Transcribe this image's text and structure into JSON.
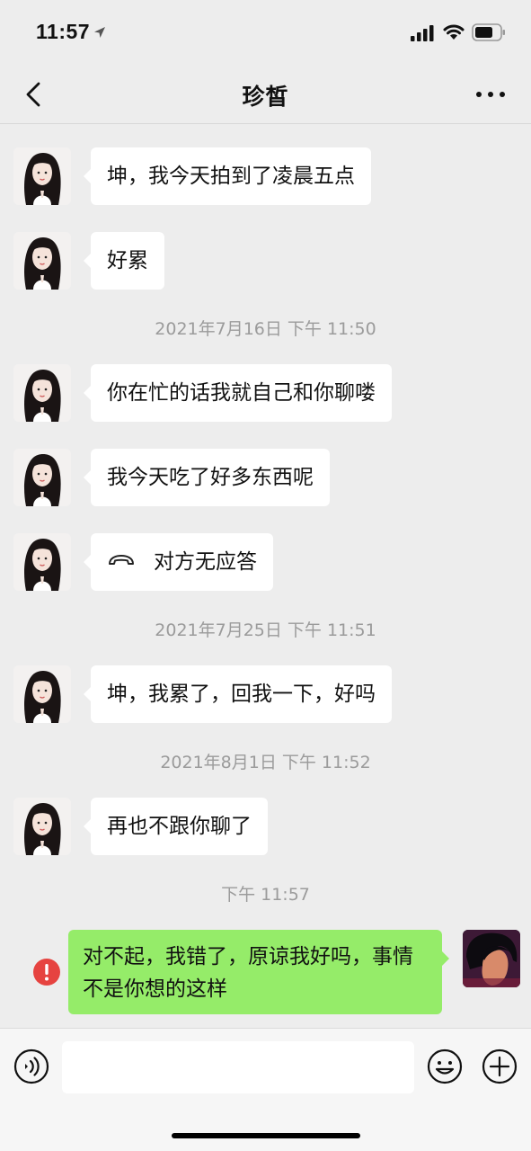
{
  "status_bar": {
    "time": "11:57",
    "icons": [
      "location-arrow-icon",
      "signal-icon",
      "wifi-icon",
      "battery-icon"
    ]
  },
  "nav": {
    "title": "珍皙",
    "back_icon": "chevron-left-icon",
    "more_icon": "more-dots-icon"
  },
  "messages": [
    {
      "text": "坤，我今天拍到了凌晨五点"
    },
    {
      "text": "好累"
    },
    {
      "timestamp": "2021年7月16日 下午 11:50"
    },
    {
      "text": "你在忙的话我就自己和你聊喽"
    },
    {
      "text": "我今天吃了好多东西呢"
    },
    {
      "text": "对方无应答",
      "icon": "phone-hangup-icon"
    },
    {
      "timestamp": "2021年7月25日 下午 11:51"
    },
    {
      "text": "坤，我累了，回我一下，好吗"
    },
    {
      "timestamp": "2021年8月1日 下午 11:52"
    },
    {
      "text": "再也不跟你聊了"
    },
    {
      "timestamp": "下午 11:57"
    },
    {
      "text": "对不起，我错了，原谅我好吗，事情不是你想的这样",
      "sender": "me",
      "status": "failed",
      "status_icon": "error-exclamation-icon"
    }
  ],
  "colors": {
    "background": "#ededed",
    "incoming_bubble": "#ffffff",
    "outgoing_bubble": "#95ec69",
    "error": "#e64340",
    "timestamp": "#9b9b9b"
  },
  "input_bar": {
    "value": "",
    "icons": [
      "voice-icon",
      "emoji-icon",
      "plus-icon"
    ]
  }
}
